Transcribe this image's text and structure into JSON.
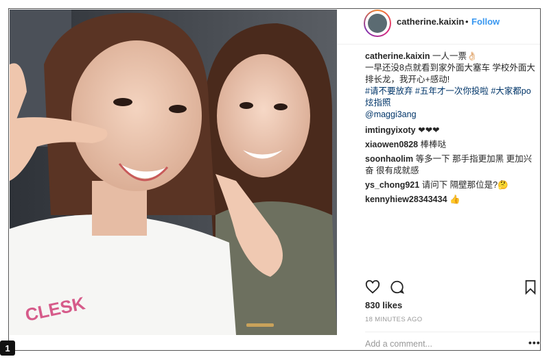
{
  "header": {
    "username": "catherine.kaixin",
    "separator": "•",
    "follow_label": "Follow"
  },
  "caption": {
    "username": "catherine.kaixin",
    "line1": "一人一票👌🏻",
    "line2": "一早还没8点就看到家外面大塞车 学校外面大排长龙，我开心+感动!",
    "hashtags": "#请不要放弃 #五年才一次你投啦 #大家都po炫指照",
    "mention": "@maggi3ang"
  },
  "comments": [
    {
      "user": "imtingyixoty",
      "text": "❤❤❤"
    },
    {
      "user": "xiaowen0828",
      "text": "棒棒哒"
    },
    {
      "user": "soonhaolim",
      "text": "等多一下 那手指更加黑 更加兴奋 很有成就感"
    },
    {
      "user": "ys_chong921",
      "text": "请问下 隔壁那位是?🤔"
    },
    {
      "user": "kennyhiew28343434",
      "text": "👍"
    }
  ],
  "likes": "830 likes",
  "timestamp": "18 MINUTES AGO",
  "add_comment_placeholder": "Add a comment...",
  "more_label": "•••",
  "corner_badge": "1"
}
